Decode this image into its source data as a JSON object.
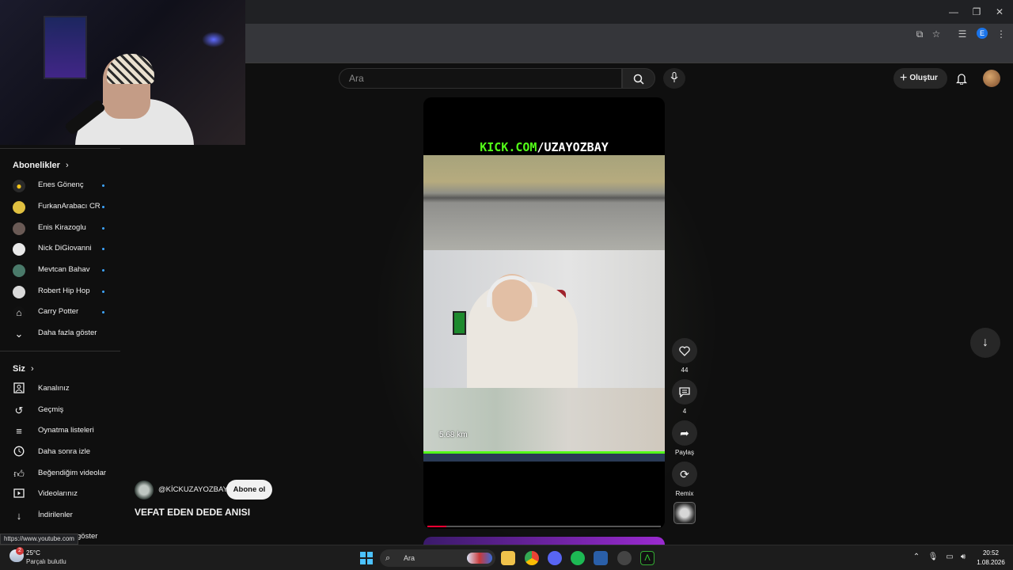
{
  "browser": {
    "profile_initial": "E"
  },
  "header": {
    "search_placeholder": "Ara",
    "create_label": "Oluştur"
  },
  "sidebar": {
    "subscriptions_heading": "Abonelikler",
    "subscriptions": [
      {
        "name": "Enes Gönenç",
        "new": true
      },
      {
        "name": "FurkanArabacı CR",
        "new": true
      },
      {
        "name": "Enis Kirazoglu",
        "new": true
      },
      {
        "name": "Nick DiGiovanni",
        "new": true
      },
      {
        "name": "Mevtcan Bahav",
        "new": true
      },
      {
        "name": "Robert Hip Hop",
        "new": true
      },
      {
        "name": "Carry Potter",
        "new": true
      }
    ],
    "show_more": "Daha fazla göster",
    "you_heading": "Siz",
    "you_items": [
      {
        "label": "Kanalınız",
        "icon": "account-box-icon"
      },
      {
        "label": "Geçmiş",
        "icon": "history-icon"
      },
      {
        "label": "Oynatma listeleri",
        "icon": "playlist-icon"
      },
      {
        "label": "Daha sonra izle",
        "icon": "clock-icon"
      },
      {
        "label": "Beğendiğim videolar",
        "icon": "thumbs-up-icon"
      },
      {
        "label": "Videolarınız",
        "icon": "video-icon"
      },
      {
        "label": "İndirilenler",
        "icon": "download-icon"
      }
    ],
    "partial_item_suffix": "göster"
  },
  "short": {
    "overlay_text_green": "KICK.COM",
    "overlay_text_white": "/UZAYOZBAY",
    "map_distance": "5.68 km",
    "progress_fraction": 0.08,
    "channel_handle": "@KİCKUZAYOZBAY",
    "subscribe_label": "Abone ol",
    "title": "VEFAT EDEN DEDE ANISI"
  },
  "actions": {
    "likes": "44",
    "comments": "4",
    "share_label": "Paylaş",
    "remix_label": "Remix"
  },
  "status_url": "https://www.youtube.com",
  "taskbar": {
    "weather_badge": "2",
    "temperature": "25°C",
    "weather_desc": "Parçalı bulutlu",
    "search_label": "Ara",
    "time": "20:52",
    "date": "1.08.2026"
  },
  "colors": {
    "kick_green": "#53fc18",
    "youtube_red": "#ff0033",
    "link_blue": "#3ea6ff"
  }
}
